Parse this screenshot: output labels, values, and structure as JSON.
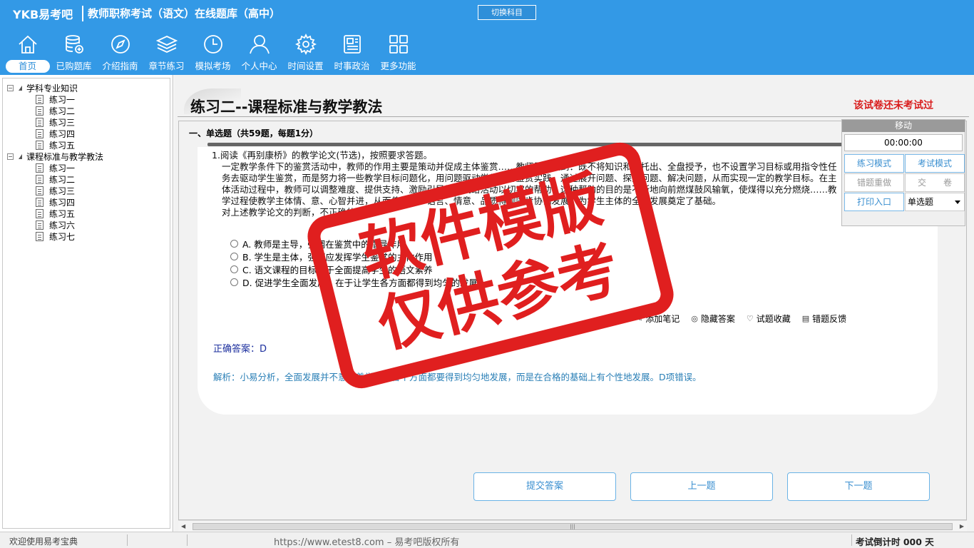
{
  "app": {
    "brand": "YKB易考吧",
    "title": "教师职称考试（语文）在线题库（高中）",
    "switch_subject": "切换科目"
  },
  "nav": [
    {
      "label": "首页",
      "icon": "home-icon"
    },
    {
      "label": "已购题库",
      "icon": "database-icon"
    },
    {
      "label": "介绍指南",
      "icon": "compass-icon"
    },
    {
      "label": "章节练习",
      "icon": "layers-icon"
    },
    {
      "label": "模拟考场",
      "icon": "clock-icon"
    },
    {
      "label": "个人中心",
      "icon": "user-icon"
    },
    {
      "label": "时间设置",
      "icon": "gear-icon"
    },
    {
      "label": "时事政治",
      "icon": "news-icon"
    },
    {
      "label": "更多功能",
      "icon": "grid-icon"
    }
  ],
  "tree": [
    {
      "label": "学科专业知识",
      "children": [
        "练习一",
        "练习二",
        "练习三",
        "练习四",
        "练习五"
      ]
    },
    {
      "label": "课程标准与教学教法",
      "children": [
        "练习一",
        "练习二",
        "练习三",
        "练习四",
        "练习五",
        "练习六",
        "练习七"
      ]
    }
  ],
  "main": {
    "page_title": "练习二--课程标准与教学教法",
    "status_notice": "该试卷还未考试过",
    "section_head": "一、单选题（共59题，每题1分）"
  },
  "question": {
    "number_text": "1.阅读《再别康桥》的教学论文(节选)，按照要求答题。",
    "paragraph": "一定教学条件下的鉴赏活动中，教师的作用主要是策动并促成主体鉴赏……教师需要做到：既不将知识和盘托出、全盘授予，也不设置学习目标或用指令性任务去驱动学生鉴赏，而是努力将一些教学目标问题化，用问题驱动学生进行鉴赏实践。通过展开问题、探究问题、解决问题，从而实现一定的教学目标。在主体活动过程中，教师可以调整难度、提供支持、激励引导等方式给活动以切实的帮助，这种帮助的目的是不断地向前燃煤鼓风输氧，使煤得以充分燃烧……教学过程使教学主体情、意、心智并进，从而使知识、语言、情意、品质得到同步协调发展，为学生主体的全面发展奠定了基础。",
    "prompt": "对上述教学论文的判断，不正确的是( )",
    "options": [
      "A. 教师是主导，强调在鉴赏中的指导作用",
      "B. 学生是主体，强调应发挥学生鉴赏的主体作用",
      "C. 语文课程的目标在于全面提高学生的语文素养",
      "D. 促进学生全面发展，在于让学生各方面都得到均匀的发展"
    ],
    "tools": [
      {
        "label": "添加笔记",
        "icon": "pen-icon"
      },
      {
        "label": "隐藏答案",
        "icon": "eye-icon"
      },
      {
        "label": "试题收藏",
        "icon": "heart-icon"
      },
      {
        "label": "错题反馈",
        "icon": "feedback-icon"
      }
    ],
    "answer": "正确答案：D",
    "explanation": "解析：小易分析，全面发展并不意味着学生的各个方面都要得到均匀地发展，而是在合格的基础上有个性地发展。D项错误。"
  },
  "buttons": {
    "submit": "提交答案",
    "prev": "上一题",
    "next": "下一题"
  },
  "panel": {
    "move": "移动",
    "timer": "00:00:00",
    "practice_mode": "练习模式",
    "exam_mode": "考试模式",
    "redo_wrong": "错题重做",
    "submit_paper": "交　　卷",
    "print": "打印入口",
    "type_select": "单选题"
  },
  "status": {
    "welcome": "欢迎使用易考宝典",
    "copyright": "https://www.etest8.com – 易考吧版权所有",
    "countdown": "考试倒计时 000 天"
  },
  "watermark": {
    "line1": "软件模版",
    "line2": "仅供参考"
  },
  "colors": {
    "brand_blue": "#3399e6",
    "stamp_red": "#e01f1f",
    "notice_red": "#d91e1e",
    "answer_blue": "#1c2f9e",
    "explain_blue": "#2a7fb6"
  }
}
